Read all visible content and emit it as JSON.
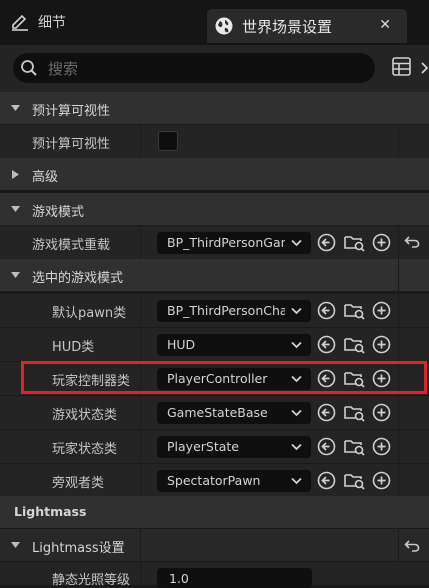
{
  "tabs": {
    "details_label": "细节",
    "world_label": "世界场景设置",
    "close_glyph": "✕"
  },
  "search": {
    "placeholder": "搜索"
  },
  "sections": {
    "precomputed": {
      "title": "预计算可视性",
      "row_label": "预计算可视性",
      "checked": false
    },
    "advanced": {
      "title": "高级"
    },
    "game_mode": {
      "title": "游戏模式",
      "override_label": "游戏模式重载",
      "override_value": "BP_ThirdPersonGameMode"
    },
    "selected_game_mode": {
      "title": "选中的游戏模式",
      "rows": [
        {
          "label": "默认pawn类",
          "value": "BP_ThirdPersonCharacter"
        },
        {
          "label": "HUD类",
          "value": "HUD"
        },
        {
          "label": "玩家控制器类",
          "value": "PlayerController"
        },
        {
          "label": "游戏状态类",
          "value": "GameStateBase"
        },
        {
          "label": "玩家状态类",
          "value": "PlayerState"
        },
        {
          "label": "旁观者类",
          "value": "SpectatorPawn"
        }
      ]
    },
    "lightmass": {
      "title": "Lightmass",
      "settings_label": "Lightmass设置",
      "partial_row_label": "静态光照等级",
      "partial_row_value": "1.0"
    }
  },
  "icons": {
    "details": "pencil-icon",
    "world": "globe-icon",
    "search": "search-icon",
    "list": "list-view-icon",
    "use_selected": "arrow-left-circle-icon",
    "browse": "folder-search-icon",
    "add": "plus-circle-icon",
    "reset": "reset-arrow-icon"
  },
  "colors": {
    "highlight": "#e0222a",
    "background": "#1a1a1a",
    "row": "#242424",
    "category": "#303030"
  }
}
